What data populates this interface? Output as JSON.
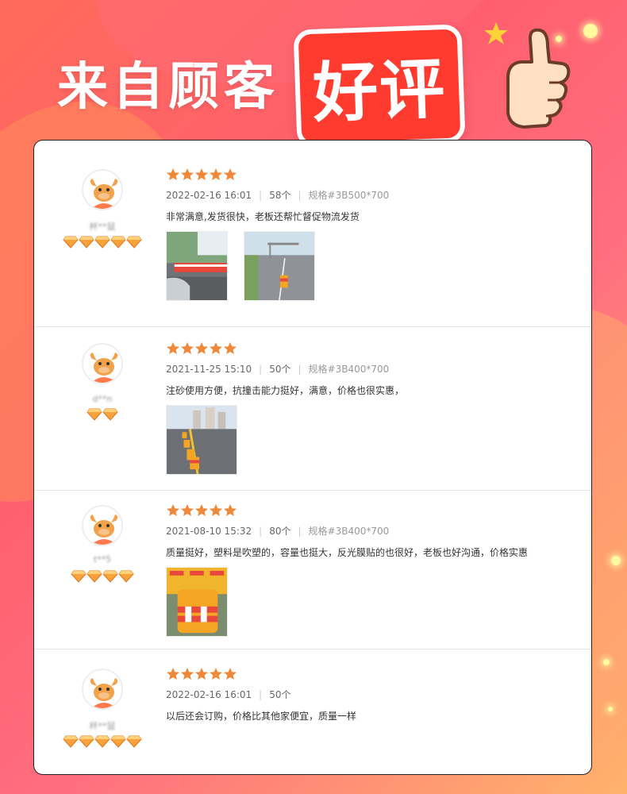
{
  "header": {
    "title_part1": "来自顾客",
    "title_part2": "好评"
  },
  "reviews": [
    {
      "username": "杯**鼠",
      "badge_count": 5,
      "stars": 5,
      "date": "2022-02-16 16:01",
      "quantity": "58个",
      "spec": "规格#3B500*700",
      "comment": "非常满意,发货很快，老板还帮忙督促物流发货",
      "photos": [
        "roadside-barrels-photo",
        "highway-barrel-photo"
      ]
    },
    {
      "username": "d**n",
      "badge_count": 2,
      "stars": 5,
      "date": "2021-11-25 15:10",
      "quantity": "50个",
      "spec": "规格#3B400*700",
      "comment": "注砂使用方便，抗撞击能力挺好，满意，价格也很实惠，",
      "photos": [
        "road-barrels-line-photo"
      ]
    },
    {
      "username": "t**5",
      "badge_count": 4,
      "stars": 5,
      "date": "2021-08-10 15:32",
      "quantity": "80个",
      "spec": "规格#3B400*700",
      "comment": "质量挺好，塑料是吹塑的，容量也挺大，反光膜贴的也很好，老板也好沟通，价格实惠",
      "photos": [
        "stacked-barrels-photo"
      ]
    },
    {
      "username": "杯**鼠",
      "badge_count": 5,
      "stars": 5,
      "date": "2022-02-16 16:01",
      "quantity": "50个",
      "spec": "",
      "comment": "以后还会订购，价格比其他家便宜，质量一样",
      "photos": []
    }
  ],
  "colors": {
    "star": "#f0883a",
    "title_bg": "#ff3a2f",
    "badge": "#f7a23a"
  }
}
